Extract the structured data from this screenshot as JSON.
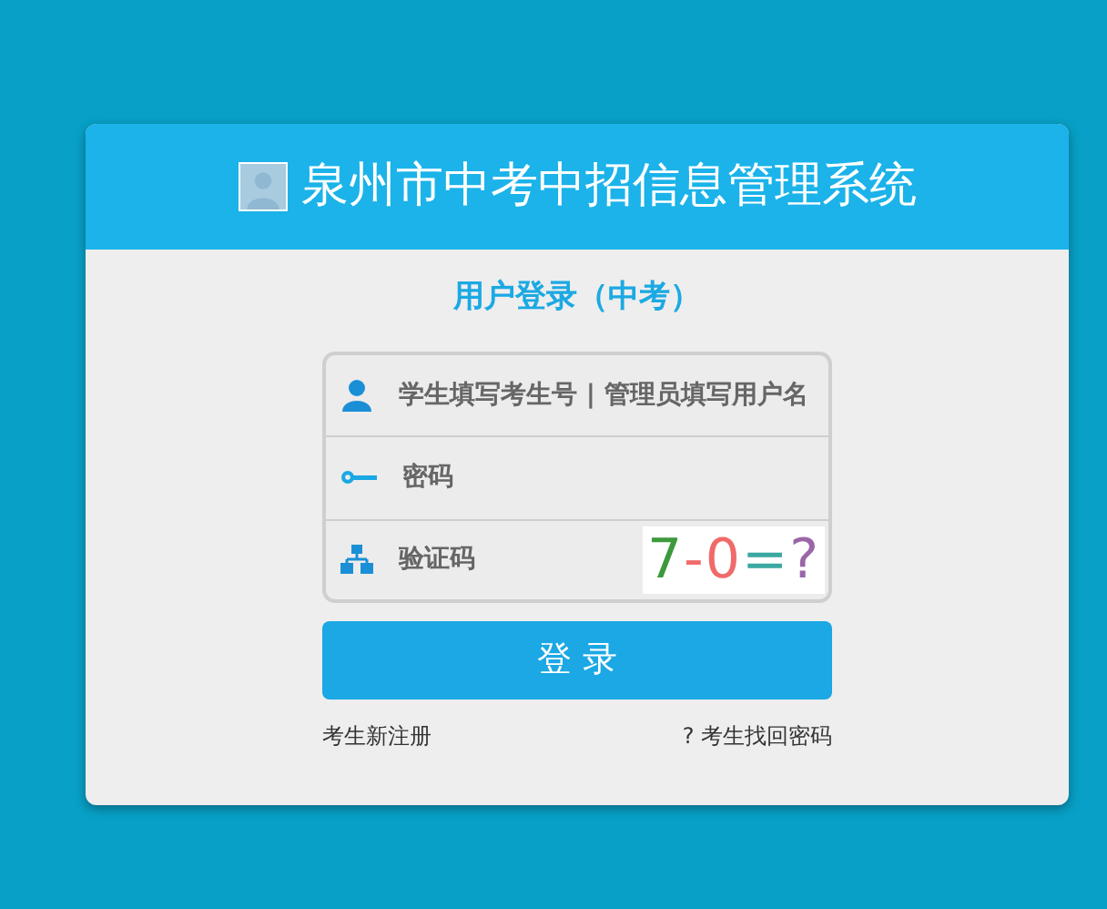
{
  "header": {
    "title": "泉州市中考中招信息管理系统"
  },
  "subtitle": "用户登录（中考）",
  "fields": [
    {
      "kind": "user",
      "placeholder": "学生填写考生号 | 管理员填写用户名"
    },
    {
      "kind": "password",
      "placeholder": "密码"
    },
    {
      "kind": "captcha",
      "placeholder": "验证码"
    }
  ],
  "captcha": [
    {
      "text": "7",
      "color": "#3c9a3c"
    },
    {
      "text": "-",
      "color": "#f06a6a"
    },
    {
      "text": "0",
      "color": "#f06a6a"
    },
    {
      "text": "=",
      "color": "#3aa8a0"
    },
    {
      "text": "?",
      "color": "#9a66a8"
    }
  ],
  "login_button": "登 录",
  "links": [
    "考生新注册",
    "? 考生找回密码"
  ]
}
